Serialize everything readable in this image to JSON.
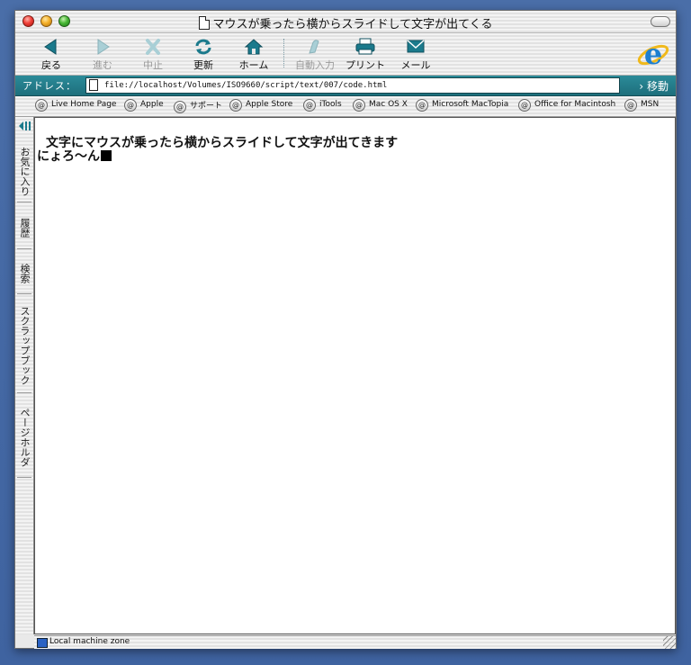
{
  "window": {
    "title": "マウスが乗ったら横からスライドして文字が出てくる"
  },
  "toolbar": {
    "buttons": [
      {
        "label": "戻る",
        "icon": "back-arrow-icon",
        "enabled": true
      },
      {
        "label": "進む",
        "icon": "forward-arrow-icon",
        "enabled": false
      },
      {
        "label": "中止",
        "icon": "stop-x-icon",
        "enabled": false
      },
      {
        "label": "更新",
        "icon": "refresh-icon",
        "enabled": true
      },
      {
        "label": "ホーム",
        "icon": "home-icon",
        "enabled": true
      },
      {
        "label": "自動入力",
        "icon": "autofill-icon",
        "enabled": false
      },
      {
        "label": "プリント",
        "icon": "printer-icon",
        "enabled": true
      },
      {
        "label": "メール",
        "icon": "mail-icon",
        "enabled": true
      }
    ]
  },
  "address": {
    "label": "アドレス：",
    "url": "file://localhost/Volumes/ISO9660/script/text/007/code.html",
    "go_label": "移動"
  },
  "favorites": [
    "Live Home Page",
    "Apple",
    "サポート",
    "Apple Store",
    "iTools",
    "Mac OS X",
    "Microsoft MacTopia",
    "Office for Macintosh",
    "MSN"
  ],
  "sidebar_tabs": [
    "お気に入り",
    "履歴",
    "検索",
    "スクラップブック",
    "ページホルダ"
  ],
  "content": {
    "headline": "文字にマウスが乗ったら横からスライドして文字が出てきます",
    "sliding_text": "にょろ〜ん"
  },
  "status": {
    "zone": "Local machine zone"
  },
  "colors": {
    "address_bar": "#1e6f7c",
    "icon_teal": "#1b7a8c",
    "desktop": "#4a6ea8"
  }
}
